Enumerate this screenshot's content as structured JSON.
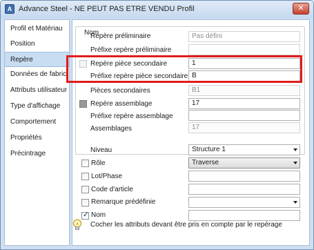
{
  "window": {
    "title": "Advance Steel - NE PEUT PAS ETRE VENDU   Profil",
    "app_icon_glyph": "A",
    "close_glyph": "✕"
  },
  "sidebar": {
    "items": [
      {
        "label": "Profil et Matériau"
      },
      {
        "label": "Position"
      },
      {
        "label": "Repère",
        "active": true
      },
      {
        "label": "Données de fabric..."
      },
      {
        "label": "Attributs utilisateur"
      },
      {
        "label": "Type d'affichage"
      },
      {
        "label": "Comportement"
      },
      {
        "label": "Propriétés"
      },
      {
        "label": "Précintrage"
      }
    ]
  },
  "nom_group": {
    "legend": "Nom",
    "repere_preliminaire": {
      "label": "Repère préliminaire",
      "value": "Pas défini"
    },
    "prefixe_repere_preliminaire": {
      "label": "Préfixe repère préliminaire",
      "value": ""
    },
    "repere_piece_secondaire": {
      "label": "Repère pièce secondaire",
      "value": "1",
      "checked": false
    },
    "prefixe_repere_piece_secondaire": {
      "label": "Préfixe repère pièce secondaire",
      "value": "B"
    },
    "pieces_secondaires": {
      "label": "Pièces secondaires",
      "value": "B1"
    },
    "repere_assemblage": {
      "label": "Repère assemblage",
      "value": "17",
      "checked": false
    },
    "prefixe_repere_assemblage": {
      "label": "Préfixe repère assemblage",
      "value": ""
    },
    "assemblages": {
      "label": "Assemblages",
      "value": "17"
    }
  },
  "lower": {
    "niveau": {
      "label": "Niveau",
      "value": "Structure 1"
    },
    "role": {
      "label": "Rôle",
      "value": "Traverse",
      "checked": false
    },
    "lot_phase": {
      "label": "Lot/Phase",
      "value": "",
      "checked": false
    },
    "code_article": {
      "label": "Code d'article",
      "value": "",
      "checked": false
    },
    "remarque_predefinie": {
      "label": "Remarque prédéfinie",
      "value": "",
      "checked": false
    },
    "nom": {
      "label": "Nom",
      "value": "",
      "checked": true
    }
  },
  "info": {
    "icon": "lightbulb-icon",
    "text": "Cocher les attributs devant être pris en compte par le repérage"
  },
  "colors": {
    "highlight": "#e01b1b",
    "selected_item": "#c8dcf2",
    "window_frame": "#cfe0f2"
  }
}
